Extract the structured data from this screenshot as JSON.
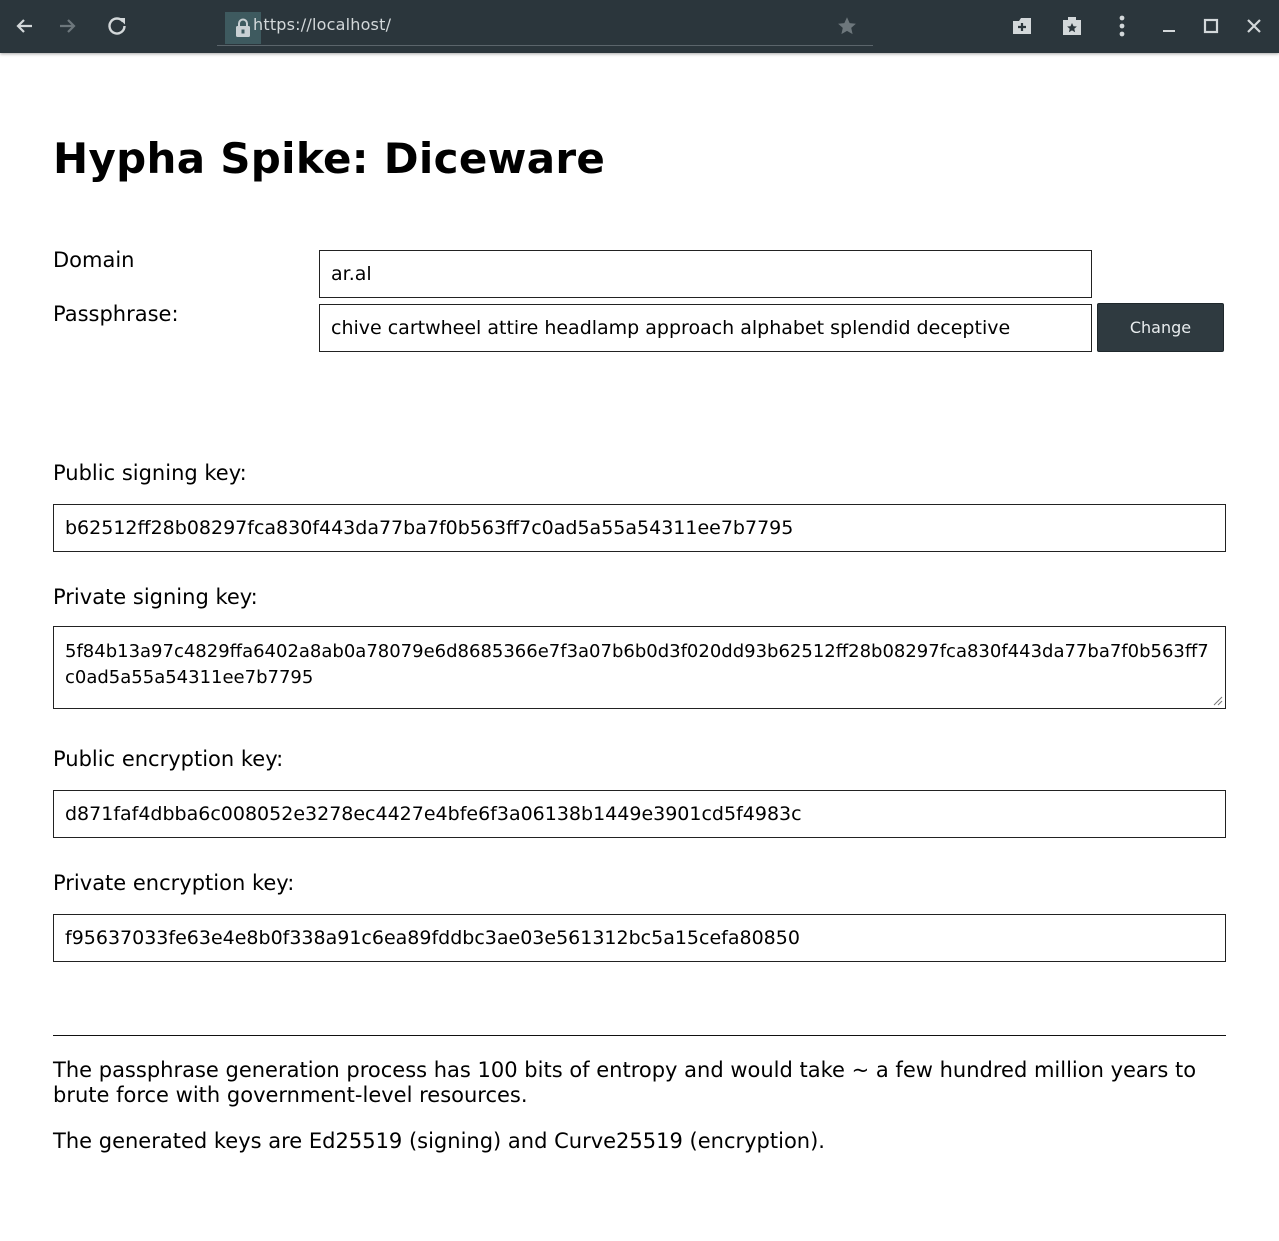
{
  "browser": {
    "url": "https://localhost/",
    "colors": {
      "toolbar_bg": "#2b363c",
      "icon": "#d3d8da",
      "icon_disabled": "#6d777c"
    },
    "icons": [
      "back-icon",
      "forward-icon",
      "reload-icon",
      "lock-icon",
      "bookmark-star-icon",
      "add-tab-icon",
      "bookmarks-icon",
      "menu-icon",
      "minimize-icon",
      "maximize-icon",
      "close-icon"
    ]
  },
  "page": {
    "title": "Hypha Spike: Diceware",
    "domain": {
      "label": "Domain",
      "value": "ar.al"
    },
    "passphrase": {
      "label": "Passphrase:",
      "value": "chive cartwheel attire headlamp approach alphabet splendid deceptive",
      "change_label": "Change"
    },
    "keys": {
      "public_signing": {
        "label": "Public signing key:",
        "value": "b62512ff28b08297fca830f443da77ba7f0b563ff7c0ad5a55a54311ee7b7795"
      },
      "private_signing": {
        "label": "Private signing key:",
        "value": "5f84b13a97c4829ffa6402a8ab0a78079e6d8685366e7f3a07b6b0d3f020dd93b62512ff28b08297fca830f443da77ba7f0b563ff7c0ad5a55a54311ee7b7795"
      },
      "public_encryption": {
        "label": "Public encryption key:",
        "value": "d871faf4dbba6c008052e3278ec4427e4bfe6f3a06138b1449e3901cd5f4983c"
      },
      "private_encryption": {
        "label": "Private encryption key:",
        "value": "f95637033fe63e4e8b0f338a91c6ea89fddbc3ae03e561312bc5a15cefa80850"
      }
    },
    "footer": {
      "entropy_note": "The passphrase generation process has 100 bits of entropy and would take ~ a few hundred million years to brute force with government-level resources.",
      "algorithms_note": "The generated keys are Ed25519 (signing) and Curve25519 (encryption)."
    },
    "colors": {
      "button_bg": "#2f3a40",
      "button_text": "#e8ecee",
      "border": "#222222"
    }
  }
}
